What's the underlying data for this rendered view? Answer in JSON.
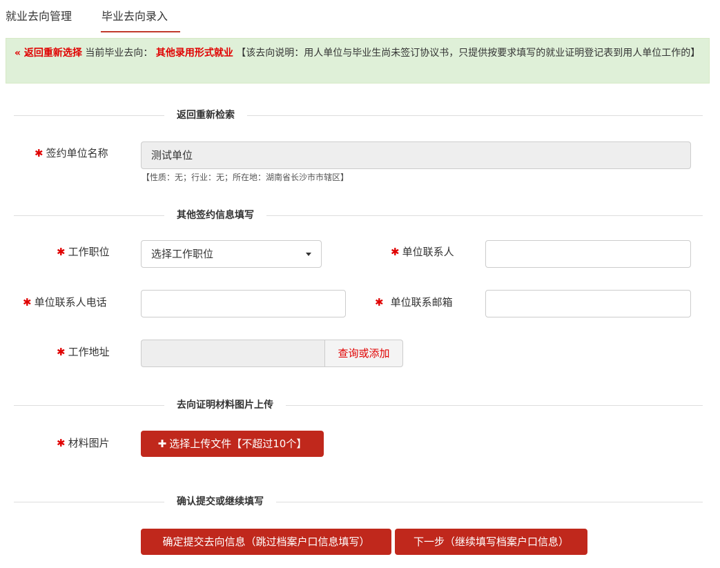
{
  "tabs": [
    {
      "label": "就业去向管理"
    },
    {
      "label": "毕业去向录入"
    }
  ],
  "notice": {
    "back_link": "« 返回重新选择",
    "current_prefix": "当前毕业去向：",
    "current_value": "其他录用形式就业",
    "description": "【该去向说明：用人单位与毕业生尚未签订协议书，只提供按要求填写的就业证明登记表到用人单位工作的】"
  },
  "sections": {
    "search": "返回重新检索",
    "other_info": "其他签约信息填写",
    "upload": "去向证明材料图片上传",
    "confirm": "确认提交或继续填写"
  },
  "form": {
    "unit_name": {
      "label": "签约单位名称",
      "value": "测试单位",
      "hint": "【性质：无；行业：无；所在地：湖南省长沙市市辖区】"
    },
    "job_position": {
      "label": "工作职位",
      "selected": "选择工作职位"
    },
    "contact_person": {
      "label": "单位联系人",
      "value": ""
    },
    "contact_phone": {
      "label": "单位联系人电话",
      "value": ""
    },
    "contact_email": {
      "label": "单位联系邮箱",
      "value": ""
    },
    "work_address": {
      "label": "工作地址",
      "value": "",
      "action": "查询或添加"
    },
    "material_images": {
      "label": "材料图片",
      "button": "选择上传文件【不超过10个】"
    }
  },
  "actions": {
    "submit": "确定提交去向信息（跳过档案户口信息填写）",
    "next": "下一步（继续填写档案户口信息）"
  },
  "colors": {
    "accent": "#c0281c",
    "required": "#e00000",
    "notice_bg": "#dff0d8"
  }
}
